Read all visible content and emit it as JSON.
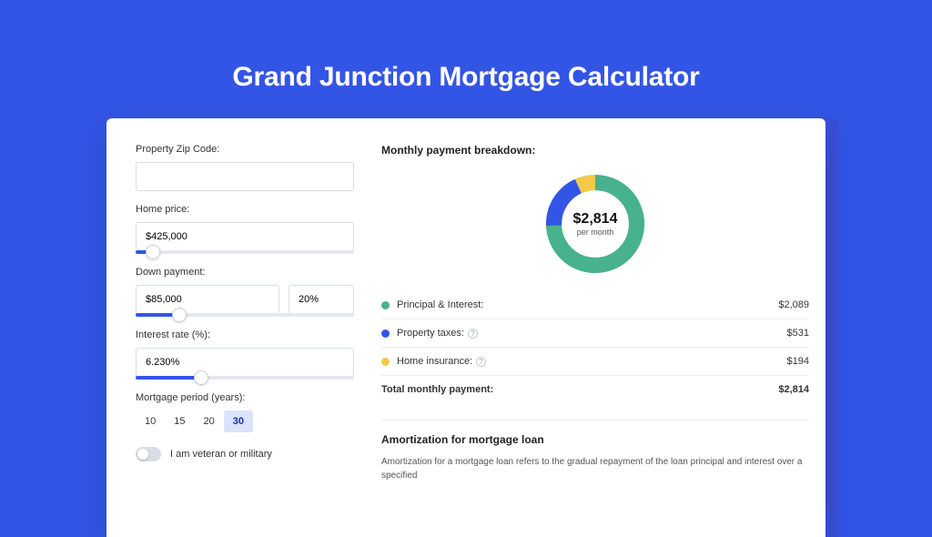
{
  "title": "Grand Junction Mortgage Calculator",
  "form": {
    "zip_label": "Property Zip Code:",
    "zip_value": "",
    "home_price_label": "Home price:",
    "home_price_value": "$425,000",
    "down_payment_label": "Down payment:",
    "down_payment_value": "$85,000",
    "down_payment_pct": "20%",
    "interest_label": "Interest rate (%):",
    "interest_value": "6.230%",
    "period_label": "Mortgage period (years):",
    "periods": [
      "10",
      "15",
      "20",
      "30"
    ],
    "period_active": "30",
    "veteran_label": "I am veteran or military"
  },
  "sliders": {
    "home_price_fill_pct": 8,
    "down_payment_fill_pct": 20,
    "interest_fill_pct": 30
  },
  "breakdown": {
    "title": "Monthly payment breakdown:",
    "center_amount": "$2,814",
    "center_sub": "per month",
    "items": [
      {
        "color": "#47B28B",
        "label": "Principal & Interest:",
        "amount": "$2,089",
        "info": false
      },
      {
        "color": "#3355E6",
        "label": "Property taxes:",
        "amount": "$531",
        "info": true
      },
      {
        "color": "#F4C94B",
        "label": "Home insurance:",
        "amount": "$194",
        "info": true
      }
    ],
    "total_label": "Total monthly payment:",
    "total_amount": "$2,814"
  },
  "chart_data": {
    "type": "pie",
    "title": "Monthly payment breakdown",
    "series": [
      {
        "name": "Principal & Interest",
        "value": 2089,
        "color": "#47B28B"
      },
      {
        "name": "Property taxes",
        "value": 531,
        "color": "#3355E6"
      },
      {
        "name": "Home insurance",
        "value": 194,
        "color": "#F4C94B"
      }
    ],
    "total": 2814
  },
  "amort": {
    "title": "Amortization for mortgage loan",
    "text": "Amortization for a mortgage loan refers to the gradual repayment of the loan principal and interest over a specified"
  }
}
